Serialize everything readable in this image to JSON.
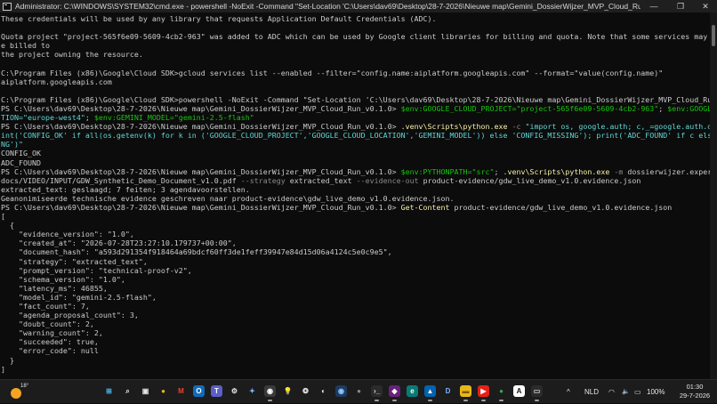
{
  "window": {
    "title": "Administrator: C:\\WINDOWS\\SYSTEM32\\cmd.exe - powershell -NoExit -Command \"Set-Location 'C:\\Users\\dav69\\Desktop\\28-7-2026\\Nieuwe map\\Gemini_DossierWijzer_MVP_Cloud_Run_v0.1.0'\"",
    "minimize": "—",
    "maximize": "❐",
    "close": "✕"
  },
  "console": {
    "lines": [
      {
        "t": [
          {
            "s": "These credentials will be used by any library that requests Application Default Credentials (ADC)."
          }
        ]
      },
      {
        "t": [
          {
            "s": ""
          }
        ]
      },
      {
        "t": [
          {
            "s": "Quota project \"project-565f6e09-5609-4cb2-963\" was added to ADC which can be used by Google client libraries for billing and quota. Note that some services may still b"
          }
        ]
      },
      {
        "t": [
          {
            "s": "e billed to"
          }
        ]
      },
      {
        "t": [
          {
            "s": "the project owning the resource."
          }
        ]
      },
      {
        "t": [
          {
            "s": ""
          }
        ]
      },
      {
        "t": [
          {
            "s": "C:\\Program Files (x86)\\Google\\Cloud SDK>gcloud services list --enabled --filter=\"config.name:aiplatform.googleapis.com\" --format=\"value(config.name)\""
          }
        ]
      },
      {
        "t": [
          {
            "s": "aiplatform.googleapis.com"
          }
        ]
      },
      {
        "t": [
          {
            "s": ""
          }
        ]
      },
      {
        "t": [
          {
            "s": "C:\\Program Files (x86)\\Google\\Cloud SDK>powershell -NoExit -Command \"Set-Location 'C:\\Users\\dav69\\Desktop\\28-7-2026\\Nieuwe map\\Gemini_DossierWijzer_MVP_Cloud_Run_v0.1.0'\""
          }
        ]
      },
      {
        "t": [
          {
            "s": "PS C:\\Users\\dav69\\Desktop\\28-7-2026\\Nieuwe map\\Gemini_DossierWijzer_MVP_Cloud_Run_v0.1.0> "
          },
          {
            "s": "$env:GOOGLE_CLOUD_PROJECT=\"project-565f6e09-5609-4cb2-963\"",
            "c": "green"
          },
          {
            "s": "; "
          },
          {
            "s": "$env:GOOGLE_CLOUD_LOCA",
            "c": "green"
          }
        ]
      },
      {
        "t": [
          {
            "s": "TION=\"europe-west4\"",
            "c": "cyan"
          },
          {
            "s": "; "
          },
          {
            "s": "$env:GEMINI_MODEL=\"gemini-2.5-flash\"",
            "c": "green"
          }
        ]
      },
      {
        "t": [
          {
            "s": "PS C:\\Users\\dav69\\Desktop\\28-7-2026\\Nieuwe map\\Gemini_DossierWijzer_MVP_Cloud_Run_v0.1.0> "
          },
          {
            "s": ".venv\\Scripts\\python.exe",
            "c": "yellow"
          },
          {
            "s": " -c ",
            "c": "gray"
          },
          {
            "s": "\"import os, google.auth; c,_=google.auth.default(); pr",
            "c": "cyan"
          }
        ]
      },
      {
        "t": [
          {
            "s": "int('CONFIG_OK' if all(os.getenv(k) for k in ('GOOGLE_CLOUD_PROJECT','GOOGLE_CLOUD_LOCATION','GEMINI_MODEL')) else 'CONFIG_MISSING'); print('ADC_FOUND' if c else 'ADC_MISSI",
            "c": "cyan"
          }
        ]
      },
      {
        "t": [
          {
            "s": "NG')\"",
            "c": "cyan"
          }
        ]
      },
      {
        "t": [
          {
            "s": "CONFIG_OK"
          }
        ]
      },
      {
        "t": [
          {
            "s": "ADC_FOUND"
          }
        ]
      },
      {
        "t": [
          {
            "s": "PS C:\\Users\\dav69\\Desktop\\28-7-2026\\Nieuwe map\\Gemini_DossierWijzer_MVP_Cloud_Run_v0.1.0> "
          },
          {
            "s": "$env:PYTHONPATH=\"src\"",
            "c": "green"
          },
          {
            "s": "; "
          },
          {
            "s": ".venv\\Scripts\\python.exe",
            "c": "yellow"
          },
          {
            "s": " -m ",
            "c": "gray"
          },
          {
            "s": "dossierwijzer.experiment --pdf"
          }
        ]
      },
      {
        "t": [
          {
            "s": "docs/VIDEO/INPUT/GDW_Synthetic_Demo_Document_v1.0.pdf"
          },
          {
            "s": " --strategy ",
            "c": "gray"
          },
          {
            "s": "extracted_text"
          },
          {
            "s": " --evidence-out ",
            "c": "gray"
          },
          {
            "s": "product-evidence/gdw_live_demo_v1.0.evidence.json"
          }
        ]
      },
      {
        "t": [
          {
            "s": "extracted_text: geslaagd; 7 feiten; 3 agendavoorstellen."
          }
        ]
      },
      {
        "t": [
          {
            "s": "Geanonimiseerde technische evidence geschreven naar product-evidence\\gdw_live_demo_v1.0.evidence.json."
          }
        ]
      },
      {
        "t": [
          {
            "s": "PS C:\\Users\\dav69\\Desktop\\28-7-2026\\Nieuwe map\\Gemini_DossierWijzer_MVP_Cloud_Run_v0.1.0> "
          },
          {
            "s": "Get-Content",
            "c": "yellow"
          },
          {
            "s": " product-evidence/gdw_live_demo_v1.0.evidence.json"
          }
        ]
      },
      {
        "t": [
          {
            "s": "["
          }
        ]
      },
      {
        "t": [
          {
            "s": "  {"
          }
        ]
      },
      {
        "t": [
          {
            "s": "    \"evidence_version\": \"1.0\","
          }
        ]
      },
      {
        "t": [
          {
            "s": "    \"created_at\": \"2026-07-28T23:27:10.179737+00:00\","
          }
        ]
      },
      {
        "t": [
          {
            "s": "    \"document_hash\": \"a593d291354f918464a69bdcf60ff3de1feff39947e84d15d06a4124c5e0c9e5\","
          }
        ]
      },
      {
        "t": [
          {
            "s": "    \"strategy\": \"extracted_text\","
          }
        ]
      },
      {
        "t": [
          {
            "s": "    \"prompt_version\": \"technical-proof-v2\","
          }
        ]
      },
      {
        "t": [
          {
            "s": "    \"schema_version\": \"1.0\","
          }
        ]
      },
      {
        "t": [
          {
            "s": "    \"latency_ms\": 46855,"
          }
        ]
      },
      {
        "t": [
          {
            "s": "    \"model_id\": \"gemini-2.5-flash\","
          }
        ]
      },
      {
        "t": [
          {
            "s": "    \"fact_count\": 7,"
          }
        ]
      },
      {
        "t": [
          {
            "s": "    \"agenda_proposal_count\": 3,"
          }
        ]
      },
      {
        "t": [
          {
            "s": "    \"doubt_count\": 2,"
          }
        ]
      },
      {
        "t": [
          {
            "s": "    \"warning_count\": 2,"
          }
        ]
      },
      {
        "t": [
          {
            "s": "    \"succeeded\": true,"
          }
        ]
      },
      {
        "t": [
          {
            "s": "    \"error_code\": null"
          }
        ]
      },
      {
        "t": [
          {
            "s": "  }"
          }
        ]
      },
      {
        "t": [
          {
            "s": "]"
          }
        ]
      },
      {
        "t": [
          {
            "s": ""
          }
        ]
      },
      {
        "t": [
          {
            "s": "PS C:\\Users\\dav69\\Desktop\\28-7-2026\\Nieuwe map\\Gemini_DossierWijzer_MVP_Cloud_Run_v0.1.0>"
          }
        ]
      }
    ]
  },
  "taskbar": {
    "weather_temp": "18°",
    "icons": [
      {
        "name": "start-icon",
        "glyph": "⊞",
        "bg": "transparent",
        "fg": "#4cc2ff"
      },
      {
        "name": "search-icon",
        "glyph": "⌕",
        "bg": "transparent",
        "fg": "#e6e6e6"
      },
      {
        "name": "task-view-icon",
        "glyph": "▣",
        "bg": "transparent",
        "fg": "#e6e6e6"
      },
      {
        "name": "chrome-icon",
        "glyph": "●",
        "bg": "transparent",
        "fg": "#e8b71a"
      },
      {
        "name": "gmail-icon",
        "glyph": "M",
        "bg": "transparent",
        "fg": "#ea4335"
      },
      {
        "name": "outlook-icon",
        "glyph": "O",
        "bg": "#0f6cbd",
        "fg": "#ffffff"
      },
      {
        "name": "teams-icon",
        "glyph": "T",
        "bg": "#5b5fc7",
        "fg": "#ffffff"
      },
      {
        "name": "settings-icon",
        "glyph": "⚙",
        "bg": "transparent",
        "fg": "#e6e6e6"
      },
      {
        "name": "copilot-icon",
        "glyph": "✦",
        "bg": "transparent",
        "fg": "#7fb2ff"
      },
      {
        "name": "obs-icon",
        "glyph": "◉",
        "bg": "#3a3a3a",
        "fg": "#ffffff"
      },
      {
        "name": "tips-icon",
        "glyph": "💡",
        "bg": "transparent",
        "fg": "#f2c811"
      },
      {
        "name": "chatgpt-icon",
        "glyph": "❂",
        "bg": "transparent",
        "fg": "#e6e6e6"
      },
      {
        "name": "github-icon",
        "glyph": "◐",
        "bg": "transparent",
        "fg": "#e6e6e6"
      },
      {
        "name": "media-icon",
        "glyph": "◉",
        "bg": "#1e3a5f",
        "fg": "#8ec5ff"
      },
      {
        "name": "app-icon",
        "glyph": "●",
        "bg": "transparent",
        "fg": "#8a8a8a"
      },
      {
        "name": "terminal-icon",
        "glyph": "›_",
        "bg": "#2b2b2b",
        "fg": "#e6e6e6"
      },
      {
        "name": "visual-studio-icon",
        "glyph": "◆",
        "bg": "#68217a",
        "fg": "#ffffff"
      },
      {
        "name": "edge-icon",
        "glyph": "e",
        "bg": "#0b7a75",
        "fg": "#ffffff"
      },
      {
        "name": "photos-icon",
        "glyph": "▲",
        "bg": "#0063b1",
        "fg": "#ffffff"
      },
      {
        "name": "d-app-icon",
        "glyph": "D",
        "bg": "transparent",
        "fg": "#7fb2ff"
      },
      {
        "name": "file-explorer-icon",
        "glyph": "▬",
        "bg": "#e8b71a",
        "fg": "#7a5a00"
      },
      {
        "name": "youtube-icon",
        "glyph": "▶",
        "bg": "#e62117",
        "fg": "#ffffff"
      },
      {
        "name": "chrome-app-icon",
        "glyph": "●",
        "bg": "transparent",
        "fg": "#34a853"
      },
      {
        "name": "a-app-icon",
        "glyph": "A",
        "bg": "#ffffff",
        "fg": "#111111"
      },
      {
        "name": "cmd-icon",
        "glyph": "▭",
        "bg": "#2b2b2b",
        "fg": "#cfcfcf"
      }
    ],
    "tray": {
      "chevron": "^",
      "language": "NLD",
      "wifi_icon": "◠",
      "volume_icon": "🔈",
      "battery_icon": "▭",
      "battery": "100%",
      "time": "01:30",
      "date": "29-7-2026"
    }
  }
}
